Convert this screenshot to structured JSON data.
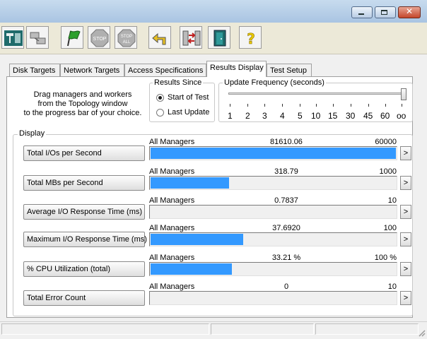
{
  "toolbar": {
    "buttons": [
      {
        "name": "display-icon"
      },
      {
        "name": "workers-icon"
      },
      {
        "name": "start-flag-icon"
      },
      {
        "name": "stop-icon",
        "text": "STOP"
      },
      {
        "name": "stop-all-icon",
        "text": "STOP ALL"
      },
      {
        "name": "reset-workers-icon"
      },
      {
        "name": "worker-config-icon"
      },
      {
        "name": "exit-icon"
      },
      {
        "name": "help-icon",
        "text": "?"
      }
    ]
  },
  "tabs": [
    {
      "label": "Disk Targets"
    },
    {
      "label": "Network Targets"
    },
    {
      "label": "Access Specifications"
    },
    {
      "label": "Results Display",
      "active": true
    },
    {
      "label": "Test Setup"
    }
  ],
  "help_text": [
    "Drag managers and workers",
    "from the Topology window",
    "to the progress bar of your choice."
  ],
  "results_since": {
    "title": "Results Since",
    "options": [
      "Start of Test",
      "Last Update"
    ],
    "selected": "Start of Test"
  },
  "update_frequency": {
    "title": "Update Frequency (seconds)",
    "ticks": [
      "1",
      "2",
      "3",
      "4",
      "5",
      "10",
      "15",
      "30",
      "45",
      "60",
      "oo"
    ],
    "selected": "oo"
  },
  "display": {
    "title": "Display",
    "metrics": [
      {
        "label": "Total I/Os per Second",
        "source": "All Managers",
        "value": "81610.06",
        "max": "60000",
        "fill": 1.0
      },
      {
        "label": "Total MBs per Second",
        "source": "All Managers",
        "value": "318.79",
        "max": "1000",
        "fill": 0.31879
      },
      {
        "label": "Average I/O Response Time (ms)",
        "source": "All Managers",
        "value": "0.7837",
        "max": "10",
        "fill": 0.0
      },
      {
        "label": "Maximum I/O Response Time (ms)",
        "source": "All Managers",
        "value": "37.6920",
        "max": "100",
        "fill": 0.37692
      },
      {
        "label": "% CPU Utilization (total)",
        "source": "All Managers",
        "value": "33.21 %",
        "max": "100 %",
        "fill": 0.3321
      },
      {
        "label": "Total Error Count",
        "source": "All Managers",
        "value": "0",
        "max": "10",
        "fill": 0.0
      }
    ],
    "more_label": ">"
  },
  "window_buttons": {
    "minimize": "minimize",
    "maximize": "maximize",
    "close": "x"
  }
}
